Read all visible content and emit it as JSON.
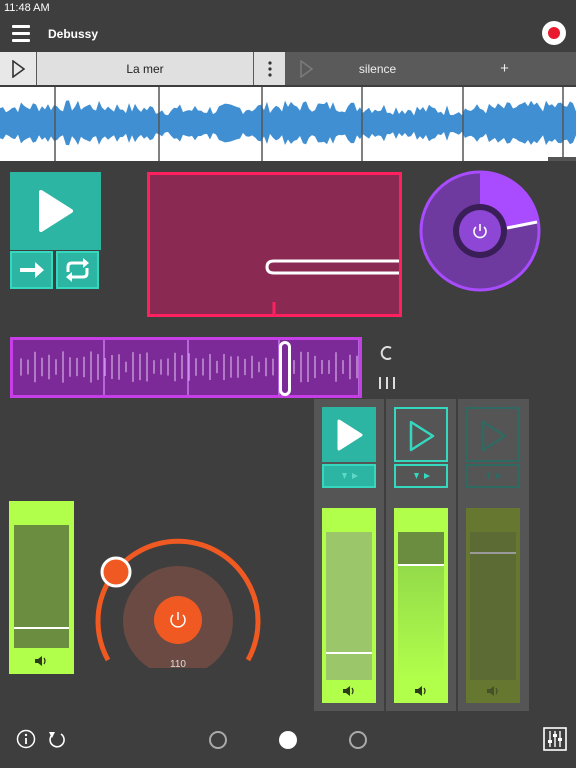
{
  "status": {
    "time": "11:48 AM"
  },
  "header": {
    "title": "Debussy",
    "menu_icon": "hamburger-menu-icon",
    "record_icon": "record-icon",
    "record_color": "#e81a2e"
  },
  "tracks": {
    "tabs": [
      {
        "label": "La mer",
        "selected": true
      },
      {
        "label": "silence",
        "selected": false
      }
    ],
    "add_label": "+"
  },
  "colors": {
    "teal": "#2bb5a2",
    "pink": "#ff2060",
    "purple": "#9b3fe6",
    "magenta": "#c63ee6",
    "orange": "#f05a22",
    "lime": "#b2ff4b",
    "wave_blue": "#3f8fd2"
  },
  "dial": {
    "value": "110"
  },
  "controls": {
    "xy_pad_value": 0.6,
    "purple_knob_level": 0.2,
    "sequencer_position": 0.78,
    "left_fader_level": 0.45,
    "strips": [
      {
        "play_active": true,
        "level": 0.18
      },
      {
        "play_active": false,
        "level": 0.82
      },
      {
        "play_active": false,
        "level": 0.9
      }
    ]
  },
  "bottom": {
    "pages": 3,
    "active_page": 2,
    "info_icon": "info-icon",
    "undo_icon": "undo-icon",
    "mixer_icon": "mixer-icon"
  }
}
